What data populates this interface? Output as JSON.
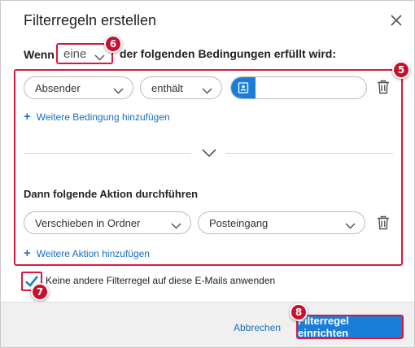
{
  "dialog": {
    "title": "Filterregeln erstellen",
    "close_icon": "close-icon"
  },
  "condition_header": {
    "prefix": "Wenn",
    "match_value": "eine",
    "suffix": "der folgenden Bedingungen erfüllt wird:"
  },
  "condition_row": {
    "field": "Absender",
    "operator": "enthält",
    "value_placeholder": "",
    "contact_icon": "contact-card-icon",
    "delete_icon": "trash-icon"
  },
  "add_condition_label": "Weitere Bedingung hinzufügen",
  "action_section_title": "Dann folgende Aktion durchführen",
  "action_row": {
    "action": "Verschieben in Ordner",
    "folder": "Posteingang",
    "delete_icon": "trash-icon"
  },
  "add_action_label": "Weitere Aktion hinzufügen",
  "stop_processing": {
    "label": "Keine andere Filterregel auf diese E-Mails anwenden",
    "checked": true
  },
  "footer": {
    "cancel_label": "Abbrechen",
    "submit_label": "Filterregel einrichten"
  },
  "markers": {
    "m5": "5",
    "m6": "6",
    "m7": "7",
    "m8": "8"
  },
  "colors": {
    "accent_blue": "#1b7ed6",
    "link_blue": "#1a6fbf",
    "highlight_red": "#d61a42",
    "marker_red": "#c8102e"
  }
}
